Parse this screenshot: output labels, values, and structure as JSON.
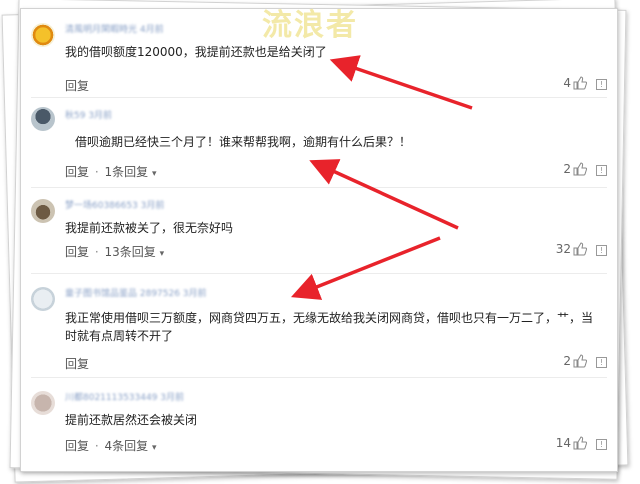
{
  "watermark": "流浪者",
  "comments": [
    {
      "nickname": "清風明月閑暇時光 4月前",
      "text": "我的借呗额度120000，我提前还款也是给关闭了",
      "reply_label": "回复",
      "reply_count": "",
      "likes": "4"
    },
    {
      "nickname": "秋59 3月前",
      "text": "借呗逾期已经快三个月了！谁来帮帮我啊，逾期有什么后果？！",
      "reply_label": "回复",
      "reply_count": "1条回复",
      "likes": "2"
    },
    {
      "nickname": "梦一场60386653 3月前",
      "text": "我提前还款被关了，很无奈好吗",
      "reply_label": "回复",
      "reply_count": "13条回复",
      "likes": "32"
    },
    {
      "nickname": "童子图书馆品鉴品 2897526 3月前",
      "text": "我正常使用借呗三万额度，网商贷四万五，无缘无故给我关闭网商贷，借呗也只有一万二了，艹，当时就有点周转不开了",
      "reply_label": "回复",
      "reply_count": "",
      "likes": "2"
    },
    {
      "nickname": "川都8021113533449 3月前",
      "text": "提前还款居然还会被关闭",
      "reply_label": "回复",
      "reply_count": "4条回复",
      "likes": "14"
    }
  ]
}
